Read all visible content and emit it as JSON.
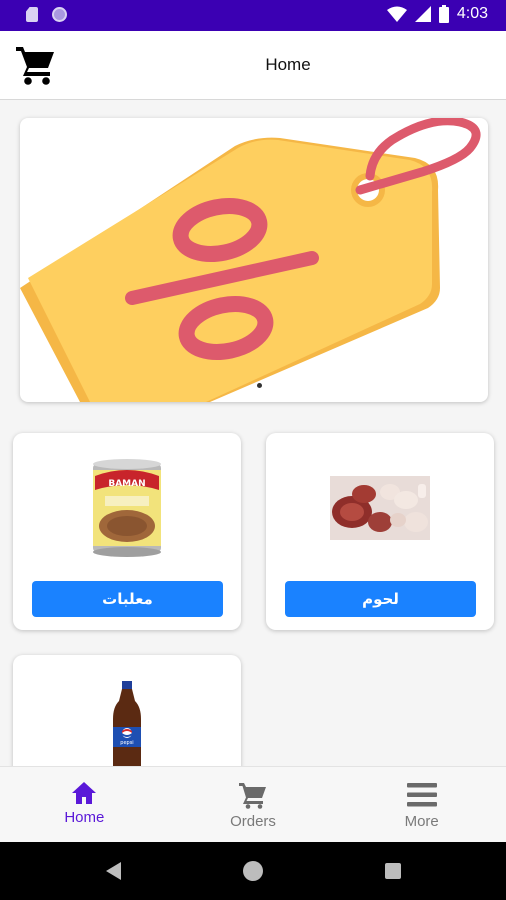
{
  "status_bar": {
    "time": "4:03",
    "icons": [
      "sd-card-icon",
      "notification-circle-icon",
      "wifi-icon",
      "cellular-signal-icon",
      "battery-icon"
    ]
  },
  "app_bar": {
    "title": "Home",
    "cart_icon": "shopping-cart-icon"
  },
  "banner": {
    "image": "discount-tag-percent-icon",
    "dots": 1,
    "colors": {
      "tag": "#fecf5f",
      "tag_shadow": "#f5b746",
      "accent": "#dd5a6c"
    }
  },
  "categories": [
    {
      "label": "لحوم",
      "image": "meat-image"
    },
    {
      "label": "معلبات",
      "image": "canned-food-image"
    },
    {
      "label": "",
      "image": "pepsi-bottle-image"
    }
  ],
  "bottom_nav": {
    "items": [
      {
        "label": "Home",
        "icon": "home-icon",
        "active": true
      },
      {
        "label": "Orders",
        "icon": "cart-icon",
        "active": false
      },
      {
        "label": "More",
        "icon": "menu-icon",
        "active": false
      }
    ]
  },
  "colors": {
    "status_bar": "#3b00b3",
    "accent": "#5a18d8",
    "button": "#1a82ff"
  }
}
